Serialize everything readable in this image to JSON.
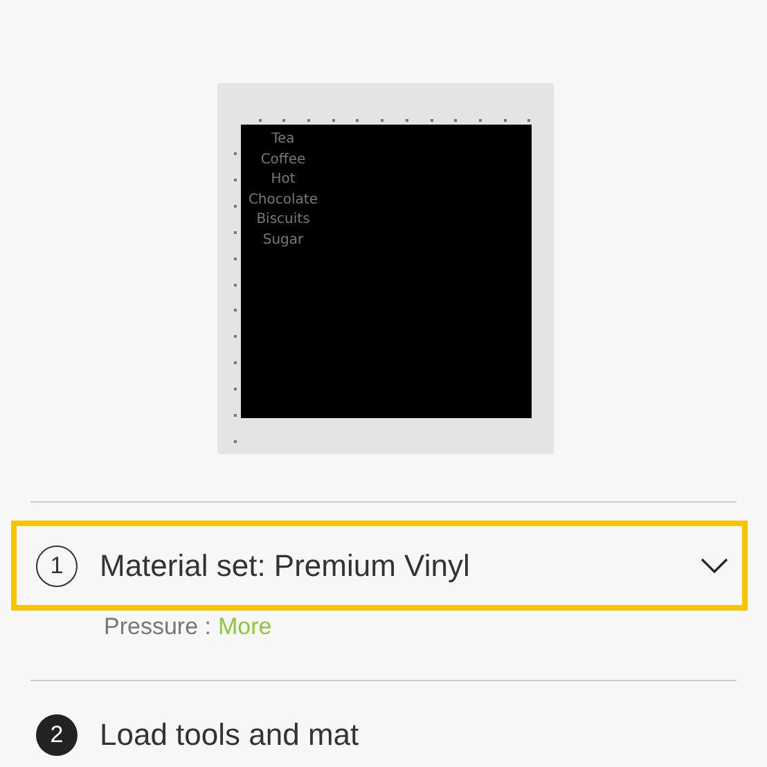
{
  "mat": {
    "lines": [
      "Tea",
      "Coffee",
      "Hot",
      "Chocolate",
      "Biscuits",
      "Sugar"
    ]
  },
  "steps": [
    {
      "number": "1",
      "title": "Material set: Premium Vinyl",
      "kind": "outline",
      "highlighted": true,
      "chevron": true,
      "detail": {
        "label": "Pressure :",
        "link": "More"
      }
    },
    {
      "number": "2",
      "title": "Load tools and mat",
      "kind": "filled",
      "highlighted": false,
      "chevron": false
    }
  ]
}
